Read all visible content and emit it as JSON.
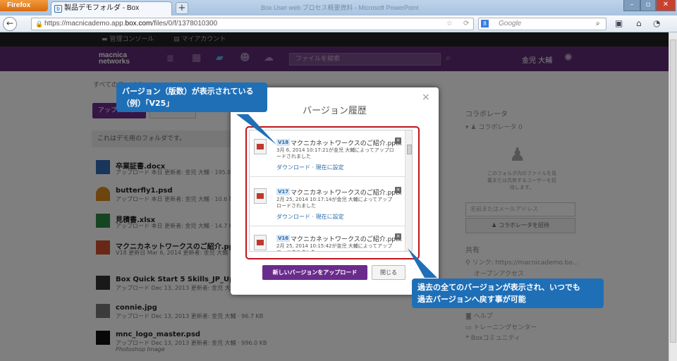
{
  "browser": {
    "app_button": "Firefox",
    "tab_title": "製品デモフォルダ - Box",
    "new_tab": "+",
    "window_title": "Box User web プロセス概要資料 - Microsoft PowerPoint",
    "url_prefix": "https://macnicademo.app.",
    "url_domain": "box.com",
    "url_path": "/files/0/f/1378010300",
    "search_placeholder": "Google"
  },
  "adminbar": {
    "console": "管理コンソール",
    "account": "マイアカウント"
  },
  "header": {
    "logo_line1": "macnica",
    "logo_line2": "networks",
    "search_placeholder": "ファイルを検索",
    "user_name": "金児 大輔"
  },
  "breadcrumb": "すべてのファイル",
  "upload_label": "アップロード",
  "folder_description": "これはデモ用のフォルダです。",
  "files": [
    {
      "name": "卒業証書.docx",
      "meta": "アップロード 本日 更新者: 金児 大輔 · 195.0 KB"
    },
    {
      "name": "butterfly1.psd",
      "meta": "アップロード 本日 更新者: 金児 大輔 · 10.6 MB"
    },
    {
      "name": "見積書.xlsx",
      "meta": "アップロード 本日 更新者: 金児 大輔 · 14.7 KB"
    },
    {
      "name": "マクニカネットワークスのご紹介.pptx",
      "meta": "V18 更新日 Mar 6, 2014 更新者: 金児 大輔 · 1.3 MB"
    },
    {
      "name": "Box Quick Start 5 Skills_JP_Update.pdf",
      "meta": "アップロード Dec 13, 2013 更新者: 金児 大輔"
    },
    {
      "name": "connie.jpg",
      "meta": "アップロード Dec 13, 2013 更新者: 金児 大輔 · 96.7 KB"
    },
    {
      "name": "mnc_logo_master.psd",
      "meta": "アップロード Dec 13, 2013 更新者: 金児 大輔 · 996.0 KB",
      "sub": "Photoshop Image"
    }
  ],
  "sidebar": {
    "collab_title": "コラボレータ",
    "collab_count": "コラボレータ 0",
    "empty_text": "このフォルダ内のファイルを見載または共有するユーザーを招待します。",
    "email_placeholder": "名前またはメールアドレス",
    "invite_button": "コラボレータを招待",
    "share_title": "共有",
    "link_label": "リンク: https://macnicademo.bo...",
    "open_access": "オープンアクセス",
    "help": "ヘルプ",
    "training": "トレーニングセンター",
    "community": "Boxコミュニティ"
  },
  "modal": {
    "title": "バージョン履歴",
    "close": "×",
    "versions": [
      {
        "badge": "V18",
        "name": "マクニカネットワークスのご紹介.pptx",
        "date": "3月 6, 2014 10:17:21が金児 大輔によってアップロードされました",
        "links": "ダウンロード · 現在に設定"
      },
      {
        "badge": "V17",
        "name": "マクニカネットワークスのご紹介.pptx",
        "date": "2月 25, 2014 10:17:14が金児 大輔によってアップロードされました",
        "links": "ダウンロード · 現在に設定"
      },
      {
        "badge": "V16",
        "name": "マクニカネットワークスのご紹介.pptx",
        "date": "2月 25, 2014 10:15:42が金児 大輔によってアップロードされました",
        "links": ""
      }
    ],
    "upload_button": "新しいバージョンをアップロード",
    "close_button": "閉じる"
  },
  "callouts": {
    "top_line1": "バージョン（版数）が表示されている",
    "top_line2": "（例）「V25」",
    "bottom_line1": "過去の全てのバージョンが表示され、いつでも",
    "bottom_line2": "過去バージョンへ戻す事が可能"
  },
  "colors": {
    "purple": "#5e2b74",
    "callout": "#1f6fb7",
    "highlight": "#c0141a",
    "button": "#6a2c8c"
  }
}
